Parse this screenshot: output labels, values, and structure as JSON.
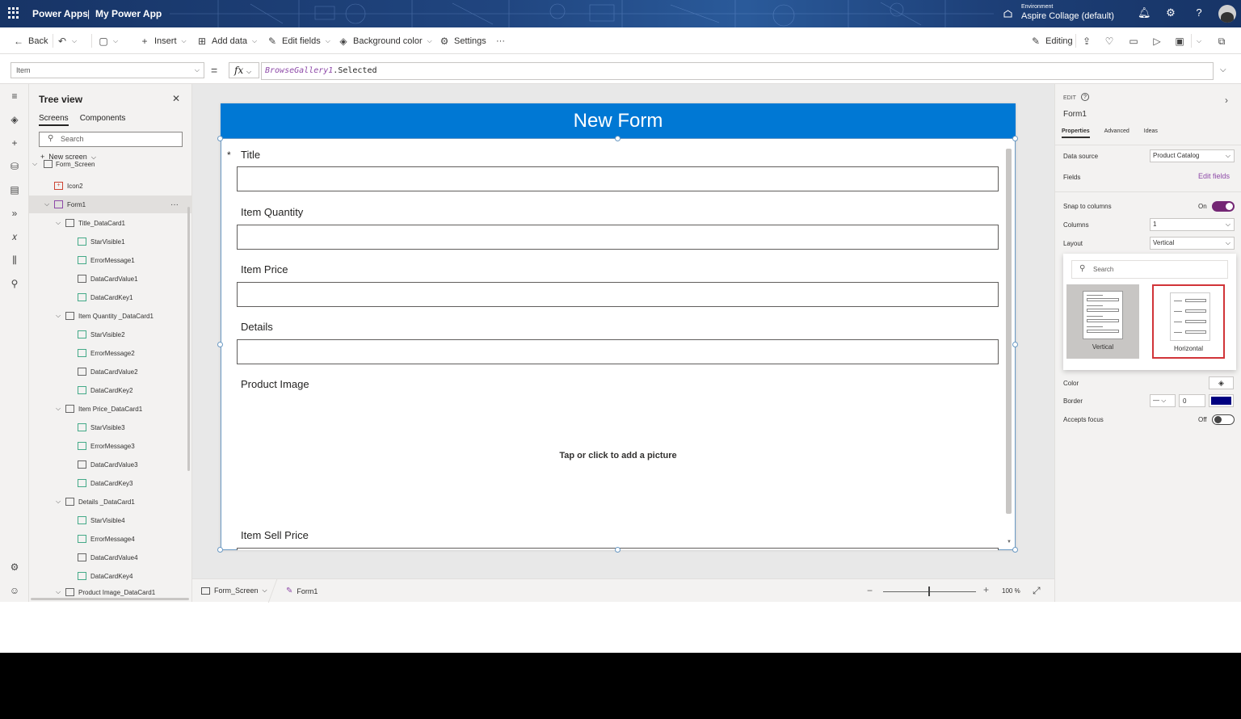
{
  "header": {
    "app_name": "Power Apps",
    "separator": "|",
    "app_title": "My Power App",
    "environment_label": "Environment",
    "environment_value": "Aspire Collage (default)"
  },
  "toolbar": {
    "back": "Back",
    "insert": "Insert",
    "add_data": "Add data",
    "edit_fields": "Edit fields",
    "background_color": "Background color",
    "settings": "Settings",
    "more": "···",
    "editing": "Editing"
  },
  "formula_bar": {
    "property": "Item",
    "equals": "=",
    "fx": "fx",
    "formula_object": "BrowseGallery1",
    "formula_rest": ".Selected"
  },
  "tree_view": {
    "title": "Tree view",
    "tabs": [
      "Screens",
      "Components"
    ],
    "search_placeholder": "Search",
    "new_screen": "New screen",
    "items": [
      {
        "label": "Form_Screen"
      },
      {
        "label": "Icon2"
      },
      {
        "label": "Form1",
        "more": "···"
      },
      {
        "label": "Title_DataCard1"
      },
      {
        "label": "StarVisible1"
      },
      {
        "label": "ErrorMessage1"
      },
      {
        "label": "DataCardValue1"
      },
      {
        "label": "DataCardKey1"
      },
      {
        "label": "Item Quantity _DataCard1"
      },
      {
        "label": "StarVisible2"
      },
      {
        "label": "ErrorMessage2"
      },
      {
        "label": "DataCardValue2"
      },
      {
        "label": "DataCardKey2"
      },
      {
        "label": "Item Price_DataCard1"
      },
      {
        "label": "StarVisible3"
      },
      {
        "label": "ErrorMessage3"
      },
      {
        "label": "DataCardValue3"
      },
      {
        "label": "DataCardKey3"
      },
      {
        "label": "Details _DataCard1"
      },
      {
        "label": "StarVisible4"
      },
      {
        "label": "ErrorMessage4"
      },
      {
        "label": "DataCardValue4"
      },
      {
        "label": "DataCardKey4"
      },
      {
        "label": "Product Image_DataCard1"
      }
    ]
  },
  "form": {
    "header": "New Form",
    "required_mark": "*",
    "fields": [
      "Title",
      "Item Quantity",
      "Item Price",
      "Details"
    ],
    "image_label": "Product Image",
    "image_hint": "Tap or click to add a picture",
    "sell_price_label": "Item Sell Price"
  },
  "status_bar": {
    "screen": "Form_Screen",
    "control": "Form1",
    "zoom_minus": "−",
    "zoom_plus": "+",
    "zoom": "100 %",
    "zoom_level": 1.0
  },
  "properties": {
    "edit_label": "EDIT",
    "control_name": "Form1",
    "tabs": [
      "Properties",
      "Advanced",
      "Ideas"
    ],
    "data_source_label": "Data source",
    "data_source_value": "Product Catalog",
    "fields_label": "Fields",
    "edit_fields_link": "Edit fields",
    "snap_label": "Snap to columns",
    "snap_state": "On",
    "columns_label": "Columns",
    "columns_value": "1",
    "layout_label": "Layout",
    "layout_value": "Vertical",
    "layout_search_placeholder": "Search",
    "layout_options": [
      "Vertical",
      "Horizontal"
    ],
    "color_label": "Color",
    "border_label": "Border",
    "border_width": "0",
    "border_color": "#000080",
    "accepts_focus_label": "Accepts focus",
    "accepts_focus_state": "Off"
  },
  "colors": {
    "form_header": "#0078d4",
    "accent": "#742774"
  }
}
